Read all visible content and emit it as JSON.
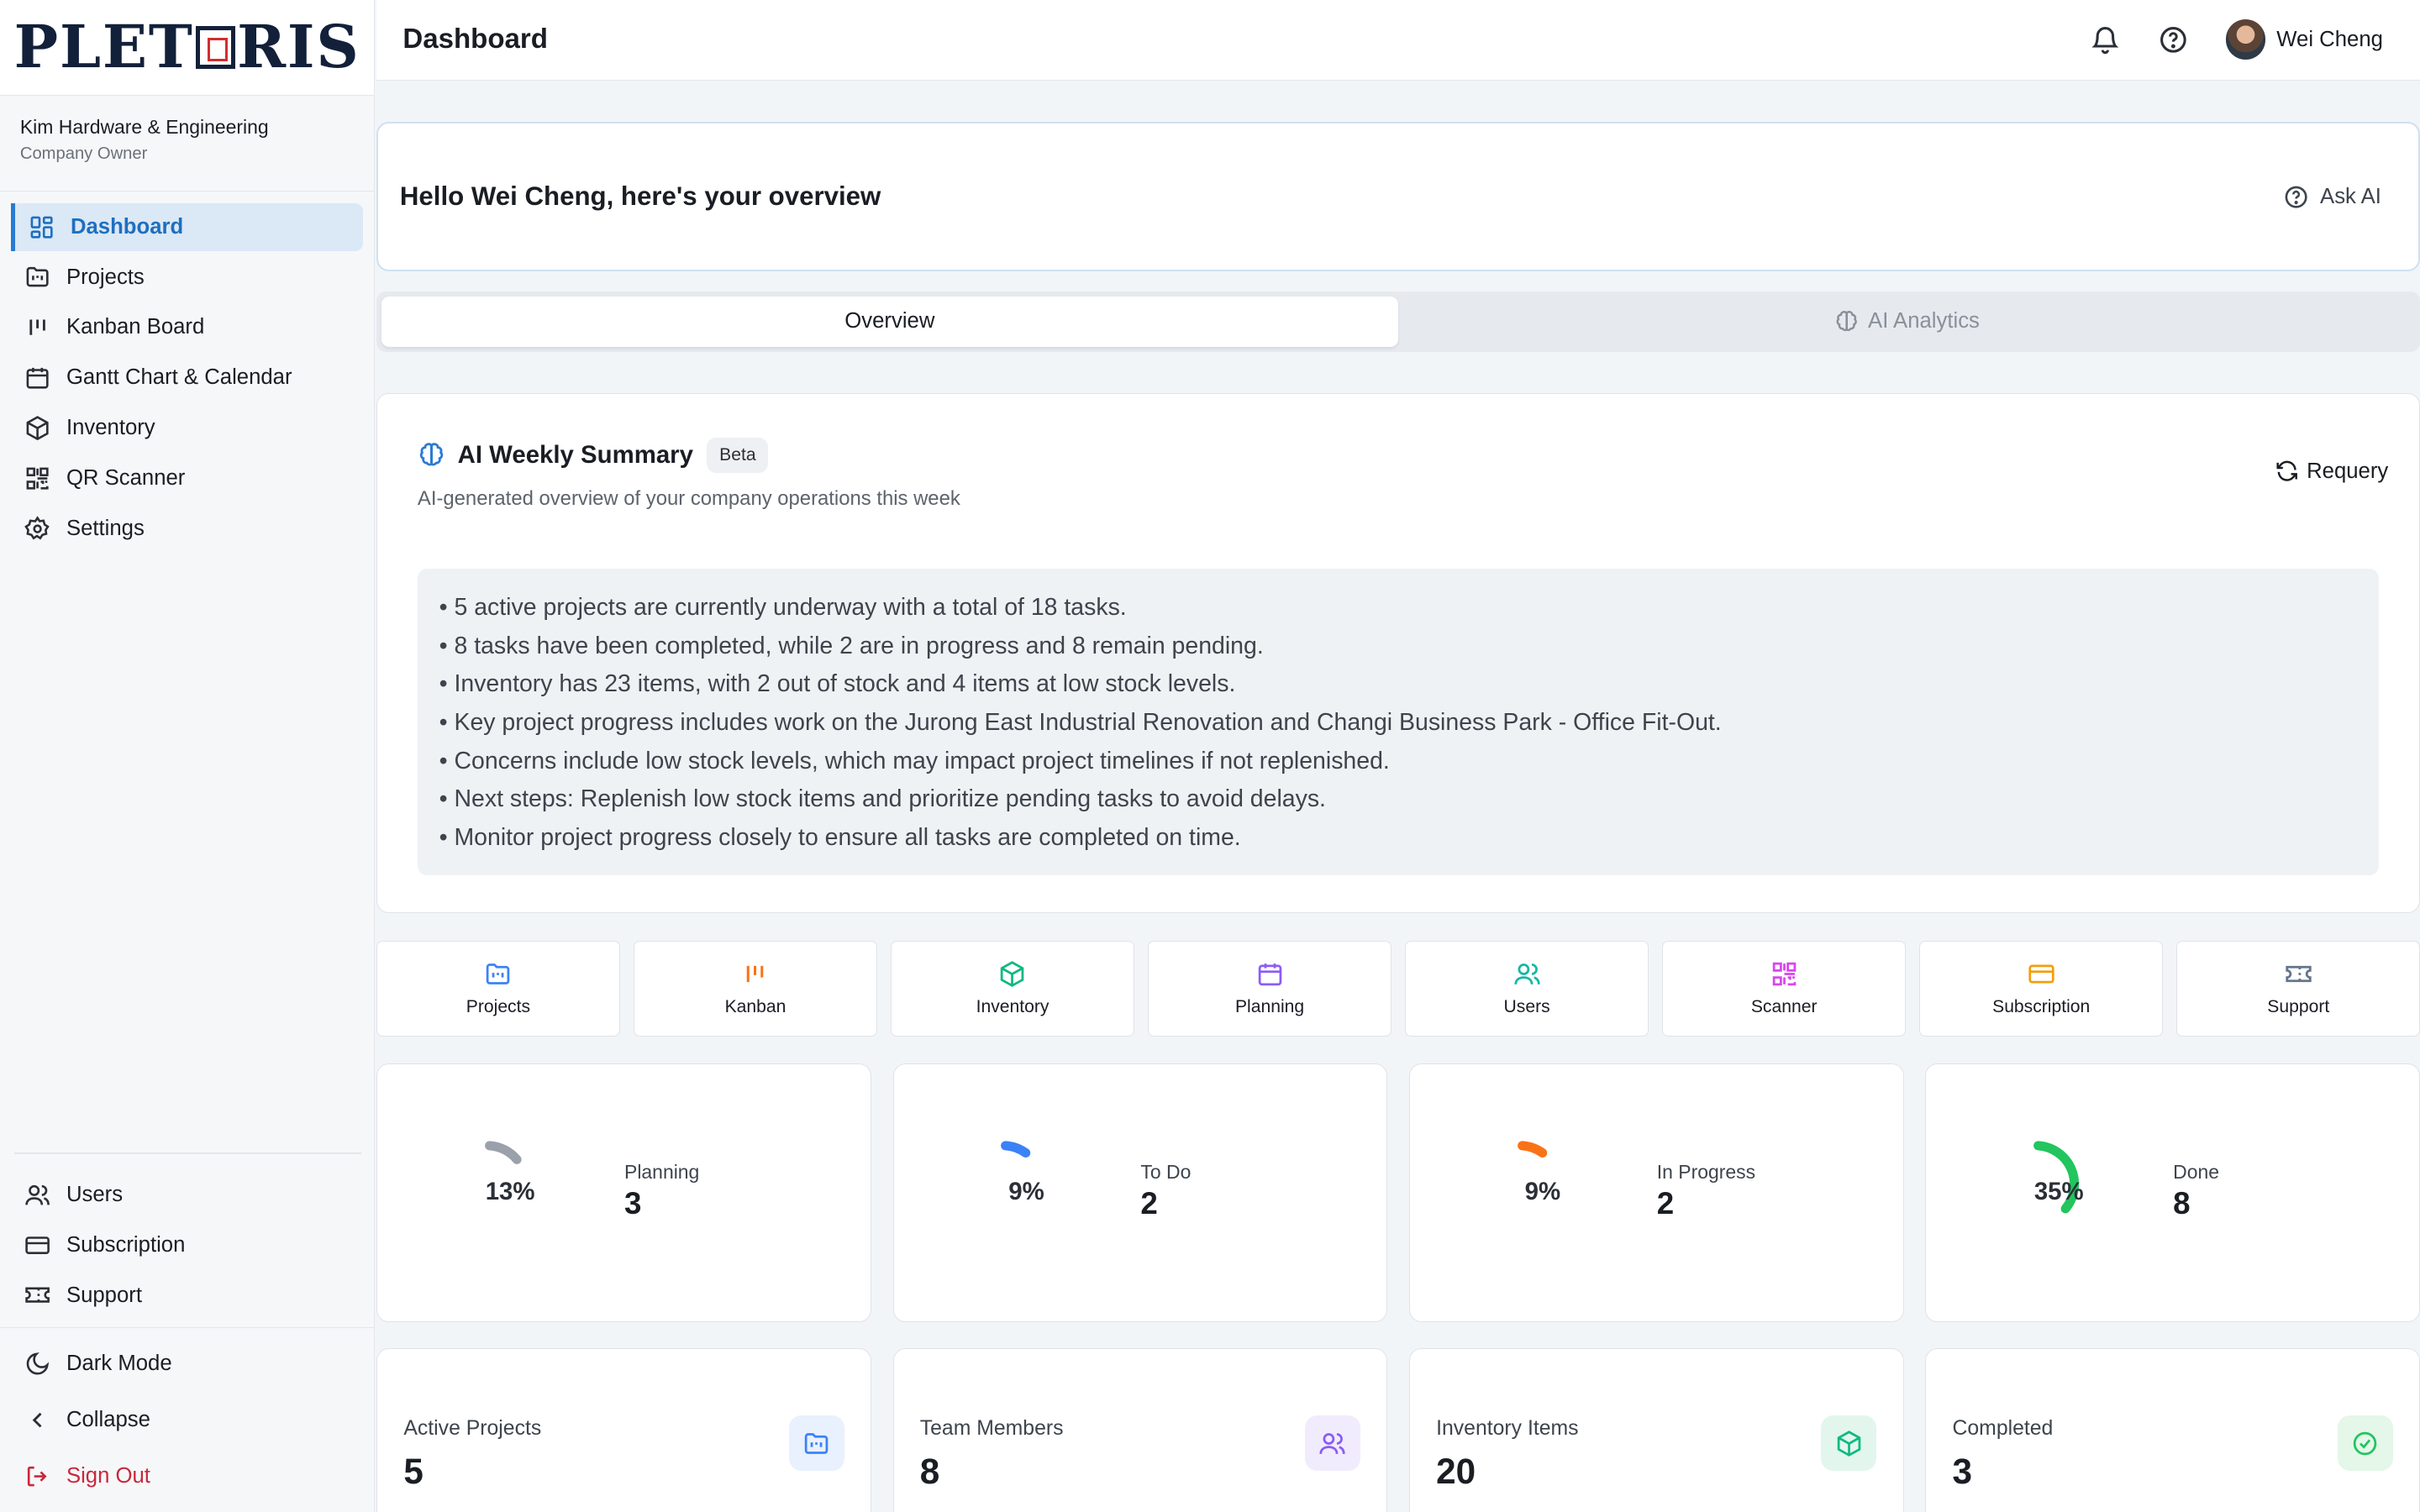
{
  "brand": {
    "logo_left": "PLET",
    "logo_right": "RIS"
  },
  "sidebar": {
    "company_name": "Kim Hardware & Engineering",
    "company_role": "Company Owner",
    "items": [
      {
        "label": "Dashboard",
        "icon": "dashboard-icon",
        "active": true
      },
      {
        "label": "Projects",
        "icon": "folder-icon"
      },
      {
        "label": "Kanban Board",
        "icon": "kanban-icon"
      },
      {
        "label": "Gantt Chart & Calendar",
        "icon": "calendar-icon"
      },
      {
        "label": "Inventory",
        "icon": "box-icon"
      },
      {
        "label": "QR Scanner",
        "icon": "qr-icon"
      },
      {
        "label": "Settings",
        "icon": "gear-icon"
      }
    ],
    "bottom_items": [
      {
        "label": "Users",
        "icon": "users-icon"
      },
      {
        "label": "Subscription",
        "icon": "card-icon"
      },
      {
        "label": "Support",
        "icon": "ticket-icon"
      }
    ],
    "footer": {
      "dark_mode": "Dark Mode",
      "collapse": "Collapse",
      "sign_out": "Sign Out"
    }
  },
  "header": {
    "title": "Dashboard",
    "username": "Wei Cheng"
  },
  "hello": {
    "text": "Hello Wei Cheng, here's your overview",
    "ask_ai": "Ask AI"
  },
  "tabs": [
    {
      "label": "Overview",
      "active": true
    },
    {
      "label": "AI Analytics",
      "active": false
    }
  ],
  "summary": {
    "title": "AI Weekly Summary",
    "badge": "Beta",
    "subtitle": "AI-generated overview of your company operations this week",
    "requery": "Requery",
    "bullets": [
      "• 5 active projects are currently underway with a total of 18 tasks.",
      "• 8 tasks have been completed, while 2 are in progress and 8 remain pending.",
      "• Inventory has 23 items, with 2 out of stock and 4 items at low stock levels.",
      "• Key project progress includes work on the Jurong East Industrial Renovation and Changi Business Park - Office Fit-Out.",
      "• Concerns include low stock levels, which may impact project timelines if not replenished.",
      "• Next steps: Replenish low stock items and prioritize pending tasks to avoid delays.",
      "• Monitor project progress closely to ensure all tasks are completed on time."
    ]
  },
  "quick_actions": [
    {
      "label": "Projects",
      "icon": "folder-icon",
      "color": "#3b82f6"
    },
    {
      "label": "Kanban",
      "icon": "kanban-icon",
      "color": "#f97316"
    },
    {
      "label": "Inventory",
      "icon": "box-icon",
      "color": "#10b981"
    },
    {
      "label": "Planning",
      "icon": "calendar-icon",
      "color": "#8b5cf6"
    },
    {
      "label": "Users",
      "icon": "users-icon",
      "color": "#14b8a6"
    },
    {
      "label": "Scanner",
      "icon": "qr-icon",
      "color": "#d946ef"
    },
    {
      "label": "Subscription",
      "icon": "card-icon",
      "color": "#f59e0b"
    },
    {
      "label": "Support",
      "icon": "ticket-icon",
      "color": "#64748b"
    }
  ],
  "status_stats": [
    {
      "label": "Planning",
      "value": "3",
      "percent_text": "13%",
      "percent": 13,
      "color": "#9aa1ab"
    },
    {
      "label": "To Do",
      "value": "2",
      "percent_text": "9%",
      "percent": 9,
      "color": "#3b82f6"
    },
    {
      "label": "In Progress",
      "value": "2",
      "percent_text": "9%",
      "percent": 9,
      "color": "#f97316"
    },
    {
      "label": "Done",
      "value": "8",
      "percent_text": "35%",
      "percent": 35,
      "color": "#22c55e"
    }
  ],
  "metrics": [
    {
      "label": "Active Projects",
      "value": "5",
      "icon": "folder-icon",
      "color": "#3b82f6",
      "bg": "#e8f1fd"
    },
    {
      "label": "Team Members",
      "value": "8",
      "icon": "users-icon",
      "color": "#8b5cf6",
      "bg": "#f1ecfd"
    },
    {
      "label": "Inventory Items",
      "value": "20",
      "icon": "box-icon",
      "color": "#10b981",
      "bg": "#e2f6ee"
    },
    {
      "label": "Completed",
      "value": "3",
      "icon": "check-circle-icon",
      "color": "#22c55e",
      "bg": "#e4f7e9"
    }
  ]
}
